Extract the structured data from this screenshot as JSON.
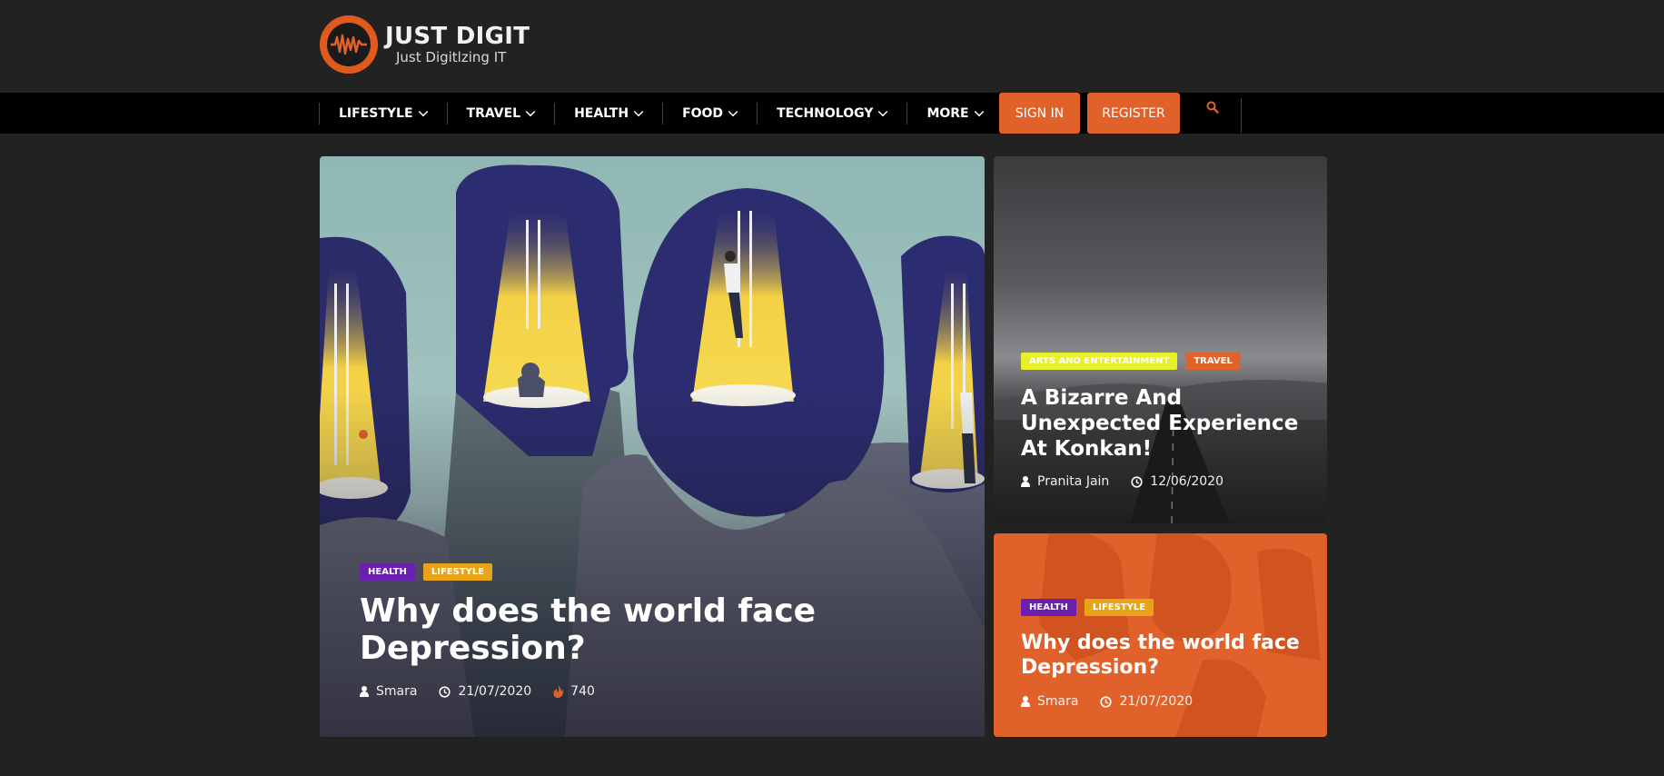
{
  "site": {
    "title": "JUST DIGIT",
    "tagline": "Just Digitlzing IT"
  },
  "nav": {
    "items": [
      {
        "label": "LIFESTYLE"
      },
      {
        "label": "TRAVEL"
      },
      {
        "label": "HEALTH"
      },
      {
        "label": "FOOD"
      },
      {
        "label": "TECHNOLOGY"
      },
      {
        "label": "MORE"
      }
    ],
    "signin_label": "SIGN IN",
    "register_label": "REGISTER",
    "search_icon": "search-icon"
  },
  "featured": {
    "main": {
      "tags": [
        "HEALTH",
        "LIFESTYLE"
      ],
      "title": "Why does the world face Depression?",
      "author": "Smara",
      "date": "21/07/2020",
      "views": "740"
    },
    "side1": {
      "tags": [
        "ARTS AND ENTERTAINMENT",
        "TRAVEL"
      ],
      "title": "A Bizarre And Unexpected Experience At Konkan!",
      "author": "Pranita Jain",
      "date": "12/06/2020"
    },
    "side2": {
      "tags": [
        "HEALTH",
        "LIFESTYLE"
      ],
      "title": "Why does the world face Depression?",
      "author": "Smara",
      "date": "21/07/2020"
    }
  },
  "colors": {
    "accent": "#e0622a",
    "health_tag": "#6a1fb0",
    "lifestyle_tag": "#e8a418",
    "arts_tag": "#e8f02a",
    "background": "#222222"
  }
}
